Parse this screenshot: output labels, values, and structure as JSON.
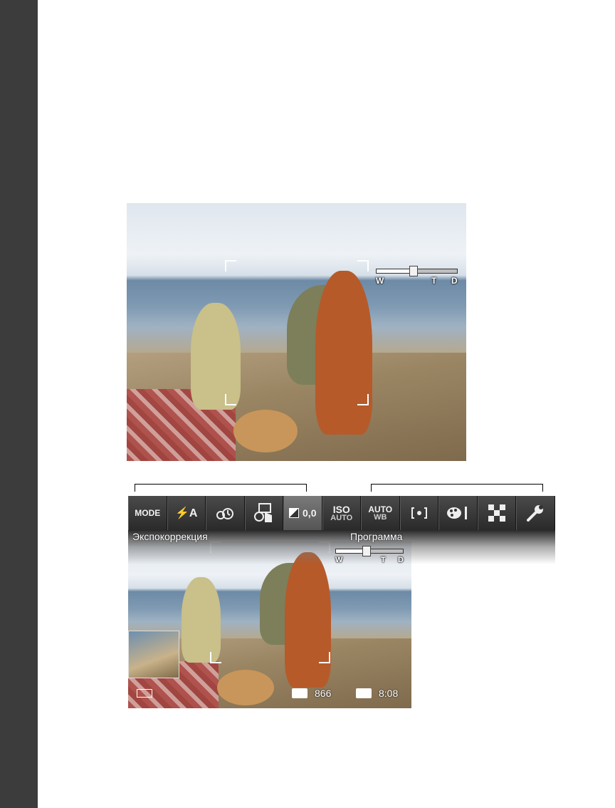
{
  "toolbar": {
    "mode": "MODE",
    "flash": "⚡A",
    "exposure_value": "0,0",
    "iso_top": "ISO",
    "iso_bottom": "AUTO",
    "wb_top": "AUTO",
    "wb_bottom": "WB"
  },
  "captions": {
    "left": "Экспокоррекция",
    "right": "Программа"
  },
  "zoom": {
    "labels": [
      "W",
      "T",
      "D"
    ],
    "level_fraction": 0.45
  },
  "status": {
    "photo_count": "866",
    "video_time": "8:08"
  },
  "icons": {
    "sidebar": "dark-bar",
    "selftimer": "self-timer-icon",
    "drive": "touch-shutter-icon",
    "metering": "spot-metering-icon",
    "color": "color-mode-icon",
    "quality": "picture-size-icon",
    "setup": "wrench-icon"
  }
}
